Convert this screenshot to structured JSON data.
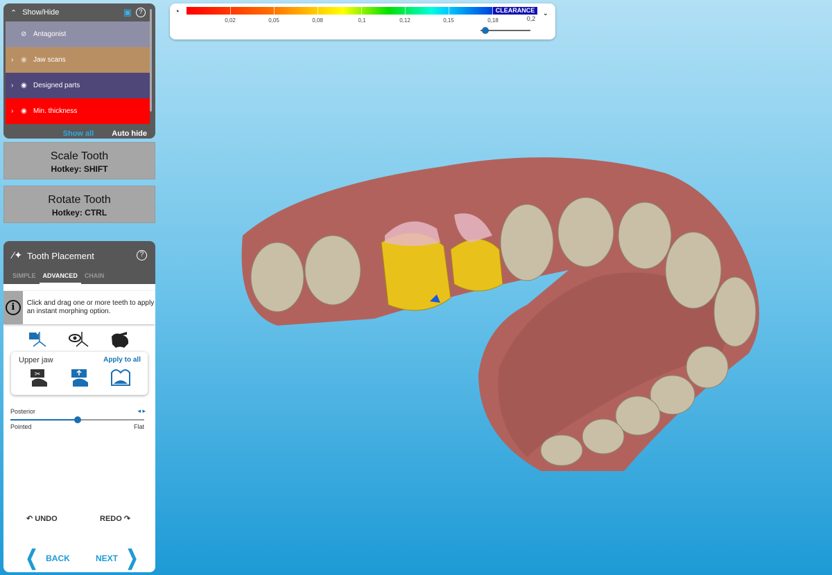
{
  "show_hide": {
    "title": "Show/Hide",
    "rows": [
      {
        "label": "Antagonist",
        "color": "#8e8ea6",
        "visible": false
      },
      {
        "label": "Jaw scans",
        "color": "#b88f63",
        "visible": true
      },
      {
        "label": "Designed parts",
        "color": "#4e4778",
        "visible": true
      },
      {
        "label": "Min. thickness",
        "color": "#ff0000",
        "visible": true
      }
    ],
    "show_all": "Show all",
    "auto_hide": "Auto hide"
  },
  "scale_tooth": {
    "title": "Scale Tooth",
    "hotkey": "Hotkey: SHIFT"
  },
  "rotate_tooth": {
    "title": "Rotate Tooth",
    "hotkey": "Hotkey: CTRL"
  },
  "tooth_placement": {
    "title": "Tooth Placement",
    "help": "?",
    "tabs": [
      "SIMPLE",
      "ADVANCED",
      "CHAIN"
    ],
    "info": "Click and drag one or more teeth to apply an instant morphing option.",
    "upper_jaw": "Upper jaw",
    "apply_all": "Apply to all",
    "slider": {
      "label": "Posterior",
      "min_label": "Pointed",
      "max_label": "Flat",
      "value": 0.5
    },
    "undo": "UNDO",
    "redo": "REDO",
    "back": "BACK",
    "next": "NEXT"
  },
  "colorbar": {
    "labels": [
      "0,02",
      "0,05",
      "0,08",
      "0,1",
      "0,12",
      "0,15",
      "0,18",
      "0,2"
    ],
    "title": "CLEARANCE",
    "slider_value": 0.05
  }
}
